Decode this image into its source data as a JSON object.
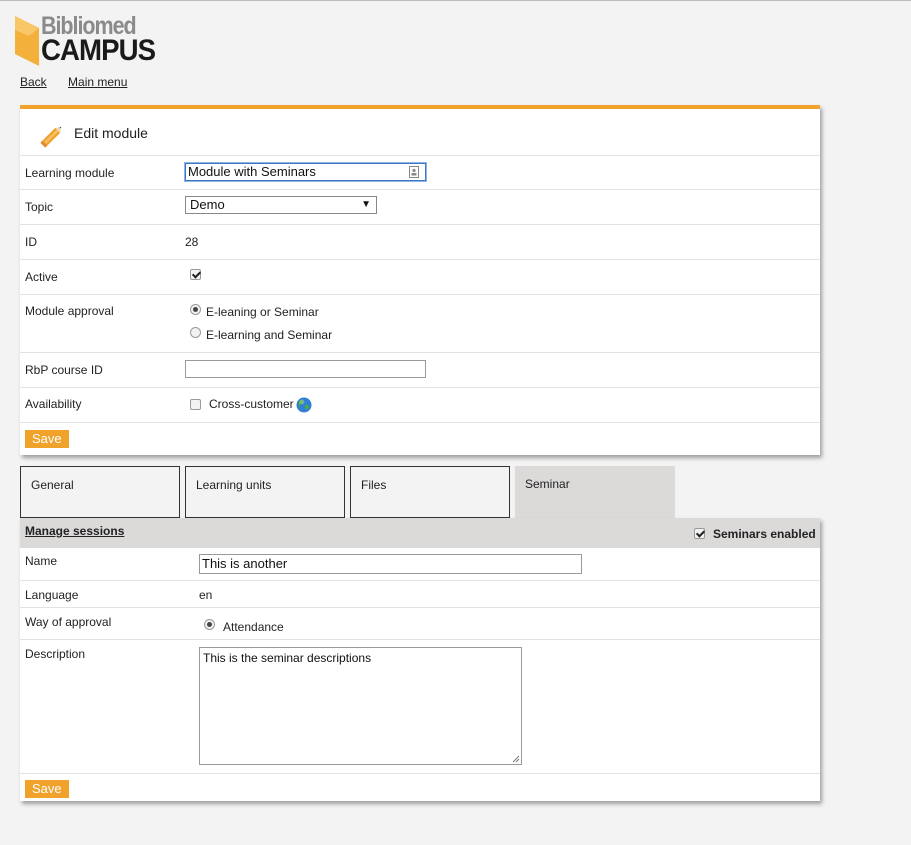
{
  "brand": {
    "line1": "Bibliomed",
    "line2": "CAMPUS"
  },
  "nav": {
    "back": "Back",
    "main_menu": "Main menu"
  },
  "edit_module": {
    "title": "Edit module",
    "learning_module": {
      "label": "Learning module",
      "value": "Module with Seminars"
    },
    "topic": {
      "label": "Topic",
      "value": "Demo"
    },
    "id": {
      "label": "ID",
      "value": "28"
    },
    "active": {
      "label": "Active",
      "checked": true
    },
    "module_approval": {
      "label": "Module approval",
      "options": [
        {
          "label": "E-leaning or Seminar",
          "selected": true
        },
        {
          "label": "E-learning and Seminar",
          "selected": false
        }
      ]
    },
    "rbp": {
      "label": "RbP course ID",
      "value": ""
    },
    "availability": {
      "label": "Availability",
      "option": "Cross-customer",
      "checked": false
    },
    "save": "Save"
  },
  "tabs": [
    {
      "label": "General",
      "active": false
    },
    {
      "label": "Learning units",
      "active": false
    },
    {
      "label": "Files",
      "active": false
    },
    {
      "label": "Seminar",
      "active": true
    }
  ],
  "seminar": {
    "manage_sessions": "Manage sessions",
    "seminars_enabled": {
      "label": "Seminars enabled",
      "checked": true
    },
    "name": {
      "label": "Name",
      "value": "This is another"
    },
    "language": {
      "label": "Language",
      "value": "en"
    },
    "approval": {
      "label": "Way of approval",
      "option": "Attendance",
      "selected": true
    },
    "description": {
      "label": "Description",
      "value": "This is the seminar descriptions"
    },
    "save": "Save"
  },
  "colors": {
    "accent": "#f0a22a",
    "tab_active": "#dcd9d9",
    "background": "#f3f3f3"
  }
}
